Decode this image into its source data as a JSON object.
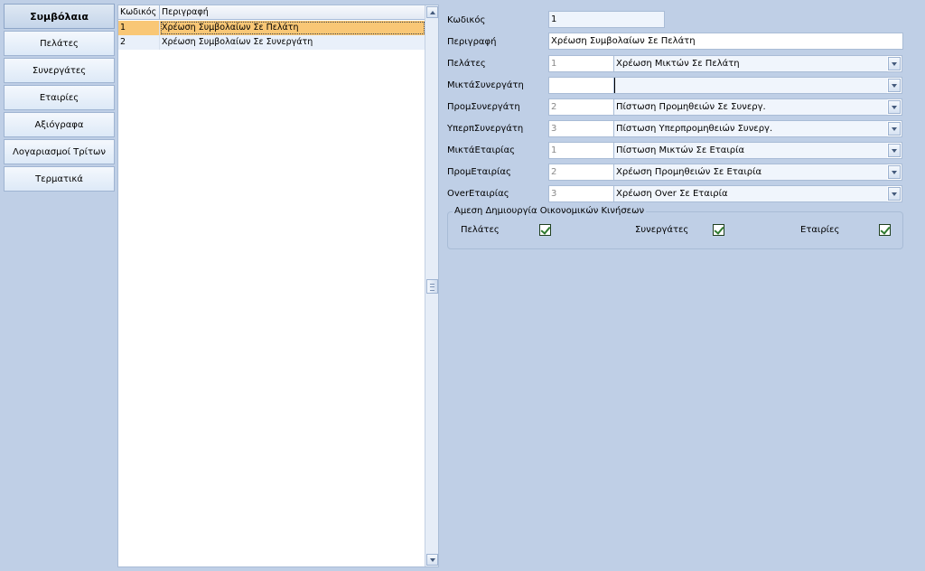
{
  "nav": {
    "items": [
      {
        "label": "Συμβόλαια"
      },
      {
        "label": "Πελάτες"
      },
      {
        "label": "Συνεργάτες"
      },
      {
        "label": "Εταιρίες"
      },
      {
        "label": "Αξιόγραφα"
      },
      {
        "label": "Λογαριασμοί Τρίτων"
      },
      {
        "label": "Τερματικά"
      }
    ]
  },
  "grid": {
    "columns": [
      "Κωδικός",
      "Περιγραφή"
    ],
    "rows": [
      {
        "code": "1",
        "description": "Χρέωση Συμβολαίων Σε Πελάτη"
      },
      {
        "code": "2",
        "description": "Χρέωση Συμβολαίων Σε Συνεργάτη"
      }
    ]
  },
  "form": {
    "code": {
      "label": "Κωδικός",
      "value": "1"
    },
    "description": {
      "label": "Περιγραφή",
      "value": "Χρέωση Συμβολαίων Σε Πελάτη"
    },
    "combos": [
      {
        "label": "Πελάτες",
        "code": "1",
        "text": "Χρέωση Μικτών Σε Πελάτη"
      },
      {
        "label": "ΜικτάΣυνεργάτη",
        "code": "",
        "text": ""
      },
      {
        "label": "ΠρομΣυνεργάτη",
        "code": "2",
        "text": "Πίστωση Προμηθειών Σε Συνεργ."
      },
      {
        "label": "ΥπερπΣυνεργάτη",
        "code": "3",
        "text": "Πίστωση Υπερπρομηθειών Συνεργ."
      },
      {
        "label": "ΜικτάΕταιρίας",
        "code": "1",
        "text": "Πίστωση Μικτών Σε Εταιρία"
      },
      {
        "label": "ΠρομΕταιρίας",
        "code": "2",
        "text": "Χρέωση Προμηθειών Σε Εταιρία"
      },
      {
        "label": "OverΕταιρίας",
        "code": "3",
        "text": "Χρέωση Over Σε Εταιρία"
      }
    ],
    "group": {
      "title": "Αμεση Δημιουργία Οικονομικών Κινήσεων",
      "checks": [
        {
          "label": "Πελάτες",
          "checked": true
        },
        {
          "label": "Συνεργάτες",
          "checked": true
        },
        {
          "label": "Εταιρίες",
          "checked": true
        }
      ]
    }
  }
}
